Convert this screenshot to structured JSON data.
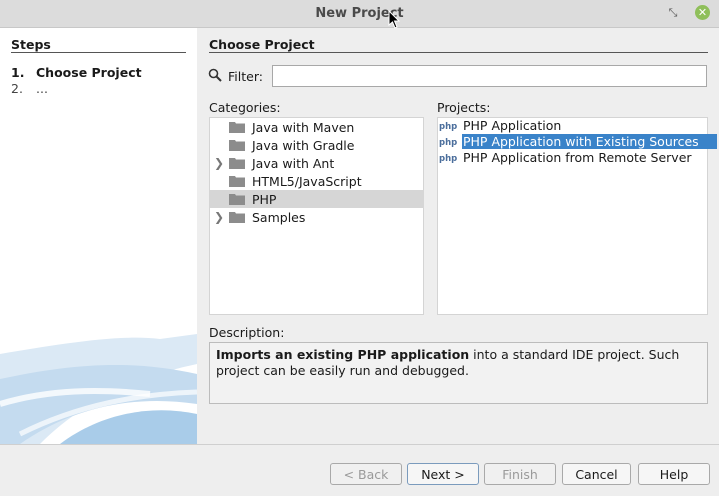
{
  "window": {
    "title": "New Project"
  },
  "steps": {
    "title": "Steps",
    "items": [
      {
        "num": "1.",
        "label": "Choose Project"
      },
      {
        "num": "2.",
        "label": "..."
      }
    ]
  },
  "main": {
    "title": "Choose Project",
    "filter": {
      "label": "Filter:",
      "value": ""
    },
    "categories_label": "Categories:",
    "projects_label": "Projects:",
    "categories": [
      {
        "label": "Java with Maven"
      },
      {
        "label": "Java with Gradle"
      },
      {
        "label": "Java with Ant"
      },
      {
        "label": "HTML5/JavaScript"
      },
      {
        "label": "PHP"
      },
      {
        "label": "Samples"
      }
    ],
    "projects": [
      {
        "label": "PHP Application"
      },
      {
        "label": "PHP Application with Existing Sources"
      },
      {
        "label": "PHP Application from Remote Server"
      }
    ],
    "selected_category": "PHP",
    "selected_project": "PHP Application with Existing Sources",
    "description_label": "Description:",
    "description_bold": "Imports an existing PHP application",
    "description_rest": " into a standard IDE project. Such project can be easily run and debugged."
  },
  "buttons": {
    "back": "< Back",
    "next": "Next >",
    "finish": "Finish",
    "cancel": "Cancel",
    "help": "Help"
  },
  "colors": {
    "selection": "#3a83c9",
    "close": "#8fbf5a"
  }
}
